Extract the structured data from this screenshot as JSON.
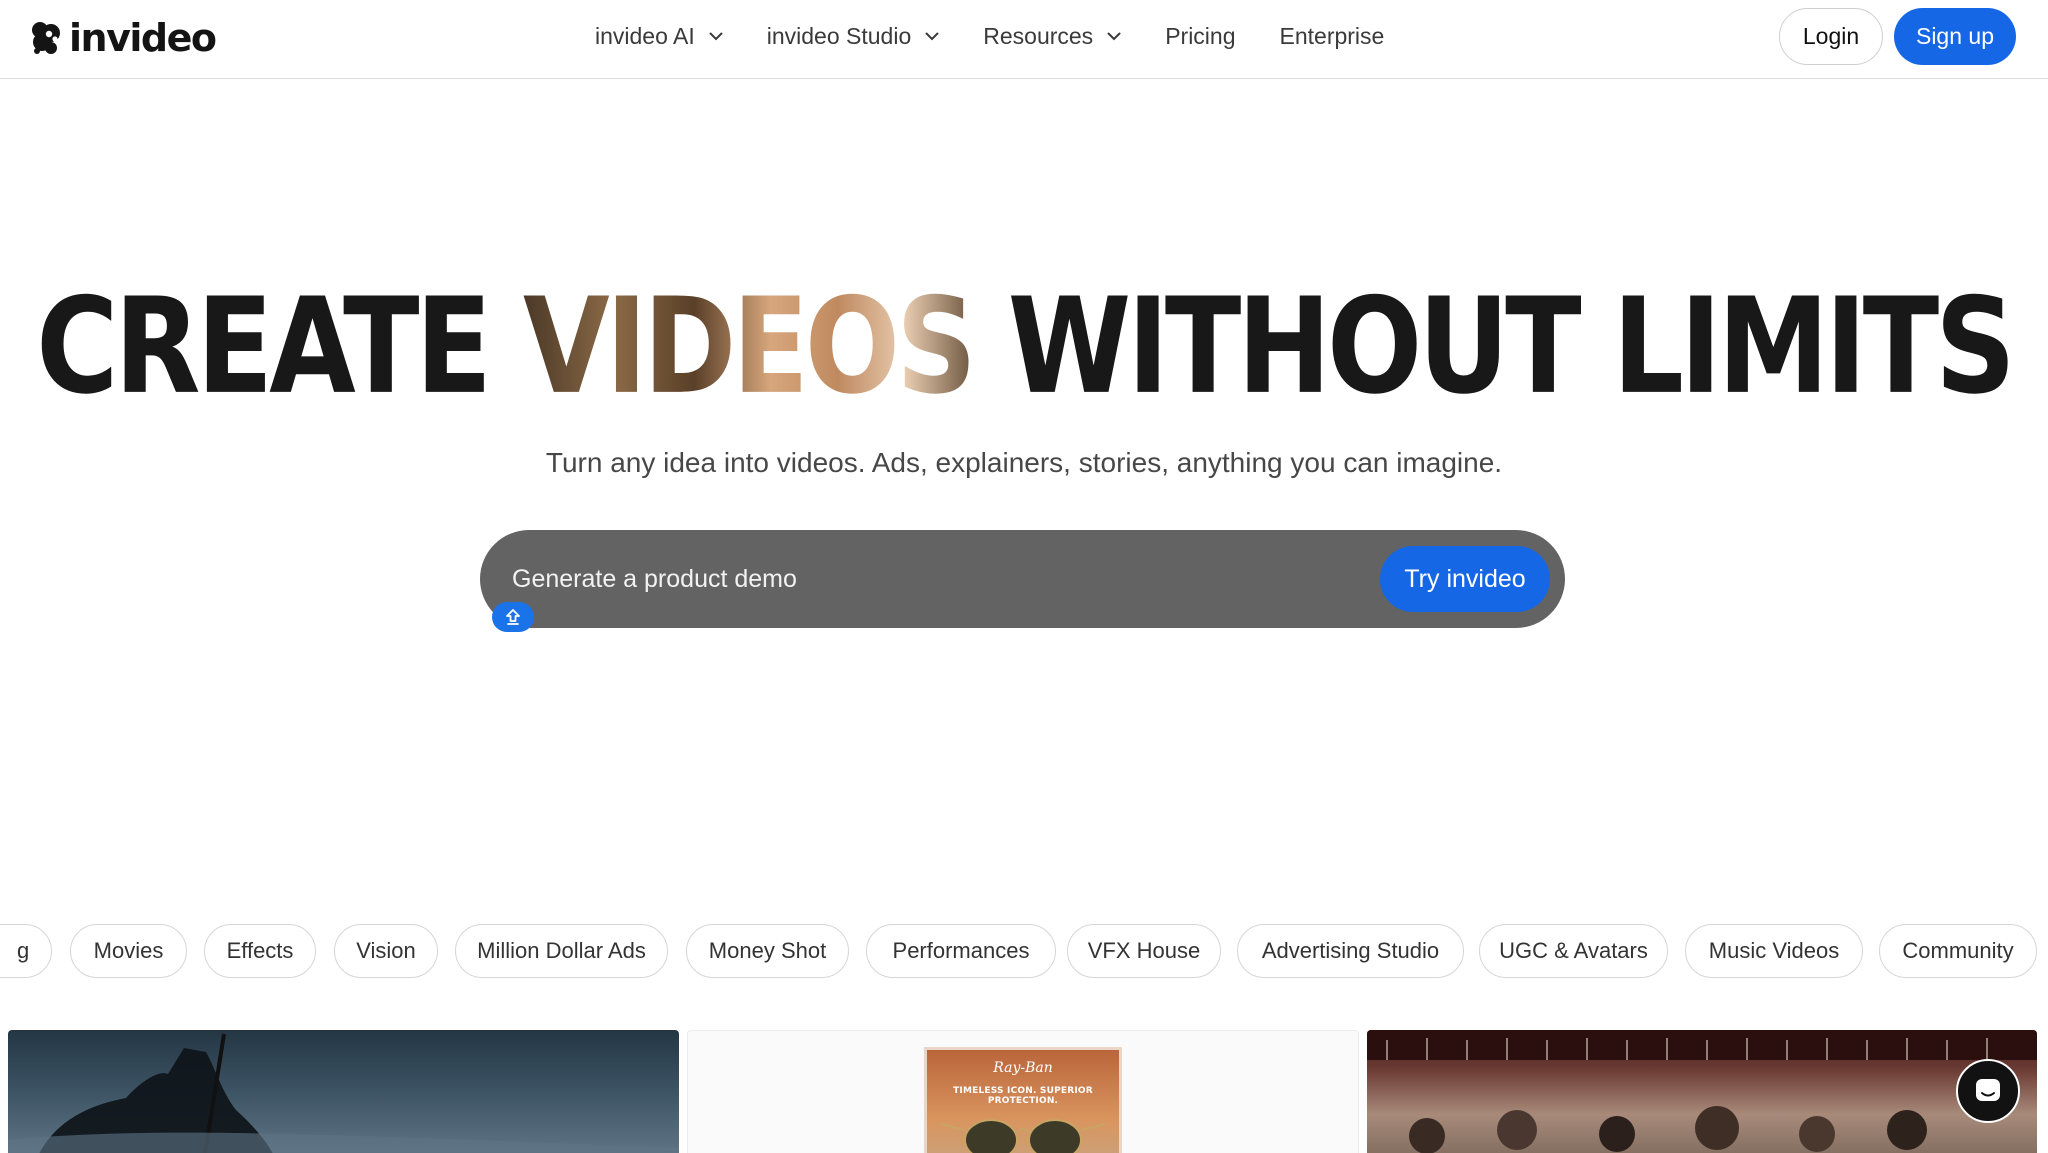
{
  "brand": {
    "name": "invideo",
    "accent": "#1667e6"
  },
  "nav": {
    "items": [
      {
        "label": "invideo AI",
        "dropdown": true
      },
      {
        "label": "invideo Studio",
        "dropdown": true
      },
      {
        "label": "Resources",
        "dropdown": true
      },
      {
        "label": "Pricing",
        "dropdown": false
      },
      {
        "label": "Enterprise",
        "dropdown": false
      }
    ],
    "login": "Login",
    "signup": "Sign up"
  },
  "hero": {
    "title_before": "CREATE ",
    "title_image_word": "VIDEOS",
    "title_after": " WITHOUT LIMITS",
    "subtitle": "Turn any idea into videos. Ads, explainers, stories, anything you can imagine.",
    "prompt_placeholder": "Generate a product demo",
    "try_label": "Try invideo"
  },
  "categories": [
    "g",
    "Movies",
    "Effects",
    "Vision",
    "Million Dollar Ads",
    "Money Shot",
    "Performances",
    "VFX House",
    "Advertising Studio",
    "UGC & Avatars",
    "Music Videos",
    "Community"
  ],
  "cards": {
    "poster_brand": "Ray-Ban",
    "poster_tagline": "TIMELESS ICON. SUPERIOR PROTECTION."
  }
}
